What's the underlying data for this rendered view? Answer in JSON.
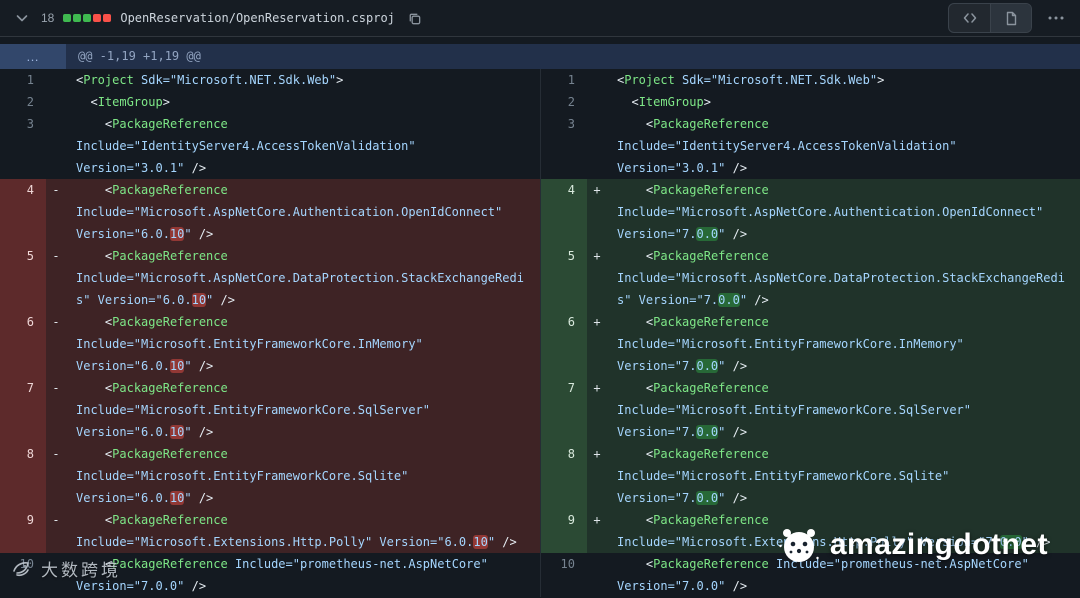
{
  "header": {
    "collapse_icon": "chevron-down-icon",
    "changes_count": "18",
    "diffstat_blocks": [
      "add",
      "add",
      "add",
      "del",
      "del"
    ],
    "filename": "OpenReservation/OpenReservation.csproj",
    "copy_icon": "copy-icon",
    "source_diff_icon": "code-icon",
    "rich_diff_icon": "file-icon",
    "more_icon": "kebab-horizontal-icon"
  },
  "hunk": {
    "expand_label": "…",
    "text": "@@ -1,19 +1,19 @@"
  },
  "diff": {
    "left": [
      {
        "num": "1",
        "sign": "",
        "type": "context",
        "text": "<Project Sdk=\"Microsoft.NET.Sdk.Web\">"
      },
      {
        "num": "2",
        "sign": "",
        "type": "context",
        "text": "  <ItemGroup>"
      },
      {
        "num": "3",
        "sign": "",
        "type": "context",
        "text": "    <PackageReference Include=\"IdentityServer4.AccessTokenValidation\" Version=\"3.0.1\" />"
      },
      {
        "num": "4",
        "sign": "-",
        "type": "del",
        "text": "    <PackageReference Include=\"Microsoft.AspNetCore.Authentication.OpenIdConnect\" Version=\"6.0.⟪10⟫\" />"
      },
      {
        "num": "5",
        "sign": "-",
        "type": "del",
        "text": "    <PackageReference Include=\"Microsoft.AspNetCore.DataProtection.StackExchangeRedis\" Version=\"6.0.⟪10⟫\" />"
      },
      {
        "num": "6",
        "sign": "-",
        "type": "del",
        "text": "    <PackageReference Include=\"Microsoft.EntityFrameworkCore.InMemory\" Version=\"6.0.⟪10⟫\" />"
      },
      {
        "num": "7",
        "sign": "-",
        "type": "del",
        "text": "    <PackageReference Include=\"Microsoft.EntityFrameworkCore.SqlServer\" Version=\"6.0.⟪10⟫\" />"
      },
      {
        "num": "8",
        "sign": "-",
        "type": "del",
        "text": "    <PackageReference Include=\"Microsoft.EntityFrameworkCore.Sqlite\" Version=\"6.0.⟪10⟫\" />"
      },
      {
        "num": "9",
        "sign": "-",
        "type": "del",
        "text": "    <PackageReference Include=\"Microsoft.Extensions.Http.Polly\" Version=\"6.0.⟪10⟫\" />"
      },
      {
        "num": "10",
        "sign": "",
        "type": "context",
        "text": "    <PackageReference Include=\"prometheus-net.AspNetCore\" Version=\"7.0.0\" />"
      }
    ],
    "right": [
      {
        "num": "1",
        "sign": "",
        "type": "context",
        "text": "<Project Sdk=\"Microsoft.NET.Sdk.Web\">"
      },
      {
        "num": "2",
        "sign": "",
        "type": "context",
        "text": "  <ItemGroup>"
      },
      {
        "num": "3",
        "sign": "",
        "type": "context",
        "text": "    <PackageReference Include=\"IdentityServer4.AccessTokenValidation\" Version=\"3.0.1\" />"
      },
      {
        "num": "4",
        "sign": "+",
        "type": "add",
        "text": "    <PackageReference Include=\"Microsoft.AspNetCore.Authentication.OpenIdConnect\" Version=\"7.⟪0.0⟫\" />"
      },
      {
        "num": "5",
        "sign": "+",
        "type": "add",
        "text": "    <PackageReference Include=\"Microsoft.AspNetCore.DataProtection.StackExchangeRedis\" Version=\"7.⟪0.0⟫\" />"
      },
      {
        "num": "6",
        "sign": "+",
        "type": "add",
        "text": "    <PackageReference Include=\"Microsoft.EntityFrameworkCore.InMemory\" Version=\"7.⟪0.0⟫\" />"
      },
      {
        "num": "7",
        "sign": "+",
        "type": "add",
        "text": "    <PackageReference Include=\"Microsoft.EntityFrameworkCore.SqlServer\" Version=\"7.⟪0.0⟫\" />"
      },
      {
        "num": "8",
        "sign": "+",
        "type": "add",
        "text": "    <PackageReference Include=\"Microsoft.EntityFrameworkCore.Sqlite\" Version=\"7.⟪0.0⟫\" />"
      },
      {
        "num": "9",
        "sign": "+",
        "type": "add",
        "text": "    <PackageReference Include=\"Microsoft.Extensions.Http.Polly\" Version=\"7.⟪0.0⟫\" />"
      },
      {
        "num": "10",
        "sign": "",
        "type": "context",
        "text": "    <PackageReference Include=\"prometheus-net.AspNetCore\" Version=\"7.0.0\" />"
      }
    ]
  },
  "watermarks": {
    "brand": "amazingdotnet",
    "brand_logo": "panda-dots-logo-icon",
    "footer": "大数跨境",
    "footer_logo": "bird-mark-icon"
  },
  "colors": {
    "page_bg": "#0d1117",
    "panel_bg": "#161c23",
    "border": "#30363d",
    "code_bg": "#141a21",
    "tag": "#7ee787",
    "string": "#a5d6ff",
    "del_row": "#3e2325",
    "del_gutter": "#5d2a2b",
    "add_row": "#20332a",
    "add_gutter": "#2b4a34",
    "hunk_row": "#22304a",
    "hunk_gutter": "#32476b",
    "stat_add": "#3fb950",
    "stat_del": "#f85149"
  }
}
